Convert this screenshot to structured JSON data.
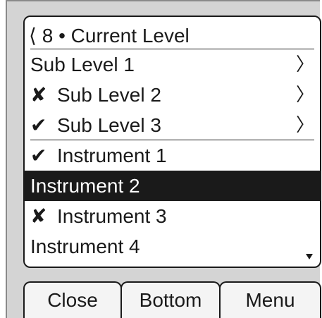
{
  "header": {
    "level_number": "8",
    "title": "Current Level"
  },
  "items": [
    {
      "label": "Sub Level 1",
      "mark": "",
      "chevron": "〉",
      "selected": false,
      "separator": false
    },
    {
      "label": "Sub Level 2",
      "mark": "✘",
      "chevron": "〉",
      "selected": false,
      "separator": false
    },
    {
      "label": "Sub Level 3",
      "mark": "✔",
      "chevron": "〉",
      "selected": false,
      "separator": true
    },
    {
      "label": "Instrument 1",
      "mark": "✔",
      "chevron": "",
      "selected": false,
      "separator": false
    },
    {
      "label": "Instrument 2",
      "mark": "",
      "chevron": "",
      "selected": true,
      "separator": false
    },
    {
      "label": "Instrument 3",
      "mark": "✘",
      "chevron": "",
      "selected": false,
      "separator": false
    },
    {
      "label": "Instrument 4",
      "mark": "",
      "chevron": "",
      "selected": false,
      "separator": false
    }
  ],
  "softkeys": {
    "close": "Close",
    "bottom": "Bottom",
    "menu": "Menu"
  },
  "colors": {
    "text": "#1a1a1a",
    "selection_bg": "#1a1a1a",
    "selection_text": "#ffffff",
    "bezel": "#d4d4d4"
  },
  "icons": {
    "back": "chevron-left-icon",
    "submenu": "chevron-right-icon",
    "checked": "checkmark-icon",
    "excluded": "cross-icon",
    "scroll": "scroll-down-arrow-icon"
  }
}
